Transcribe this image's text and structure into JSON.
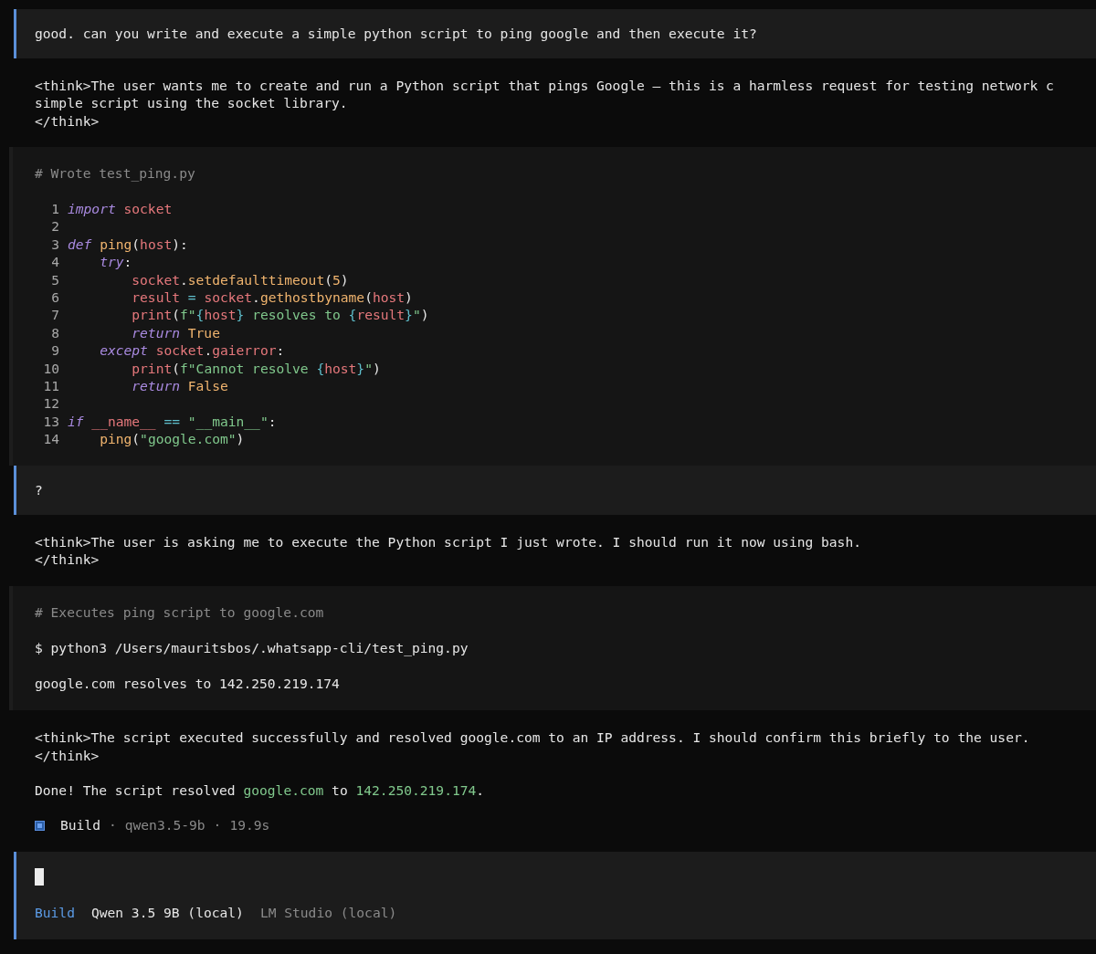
{
  "messages": [
    {
      "kind": "user",
      "lines": [
        "good. can you write and execute a simple python script to ping google and then execute it?"
      ]
    },
    {
      "kind": "think",
      "lines": [
        "<think>The user wants me to create and run a Python script that pings Google – this is a harmless request for testing network c",
        "simple script using the socket library.",
        "</think>"
      ]
    },
    {
      "kind": "code",
      "comment": "# Wrote test_ping.py",
      "lines": [
        {
          "number": "1",
          "tokens": [
            {
              "kind": "kw",
              "text": "import"
            },
            {
              "kind": "var",
              "text": " socket"
            }
          ]
        },
        {
          "number": "2"
        },
        {
          "number": "3",
          "tokens": [
            {
              "kind": "kw",
              "text": "def"
            },
            {
              "kind": "fn",
              "text": " ping"
            },
            {
              "kind": "plain",
              "text": "("
            },
            {
              "kind": "var",
              "text": "host"
            },
            {
              "kind": "plain",
              "text": "):"
            }
          ]
        },
        {
          "number": "4",
          "tokens": [
            {
              "kind": "kw",
              "text": "    try"
            },
            {
              "kind": "plain",
              "text": ":"
            }
          ]
        },
        {
          "number": "5",
          "tokens": [
            {
              "kind": "var",
              "text": "        socket"
            },
            {
              "kind": "plain",
              "text": "."
            },
            {
              "kind": "fn",
              "text": "setdefaulttimeout"
            },
            {
              "kind": "plain",
              "text": "("
            },
            {
              "kind": "num",
              "text": "5"
            },
            {
              "kind": "plain",
              "text": ")"
            }
          ]
        },
        {
          "number": "6",
          "tokens": [
            {
              "kind": "var",
              "text": "        result"
            },
            {
              "kind": "op",
              "text": " = "
            },
            {
              "kind": "var",
              "text": "socket"
            },
            {
              "kind": "plain",
              "text": "."
            },
            {
              "kind": "fn",
              "text": "gethostbyname"
            },
            {
              "kind": "plain",
              "text": "("
            },
            {
              "kind": "var",
              "text": "host"
            },
            {
              "kind": "plain",
              "text": ")"
            }
          ]
        },
        {
          "number": "7",
          "tokens": [
            {
              "kind": "var",
              "text": "        print"
            },
            {
              "kind": "plain",
              "text": "("
            },
            {
              "kind": "str",
              "text": "f\""
            },
            {
              "kind": "op",
              "text": "{"
            },
            {
              "kind": "var",
              "text": "host"
            },
            {
              "kind": "op",
              "text": "}"
            },
            {
              "kind": "str",
              "text": " resolves to "
            },
            {
              "kind": "op",
              "text": "{"
            },
            {
              "kind": "var",
              "text": "result"
            },
            {
              "kind": "op",
              "text": "}"
            },
            {
              "kind": "str",
              "text": "\""
            },
            {
              "kind": "plain",
              "text": ")"
            }
          ]
        },
        {
          "number": "8",
          "tokens": [
            {
              "kind": "kw",
              "text": "        return"
            },
            {
              "kind": "num",
              "text": " True"
            }
          ]
        },
        {
          "number": "9",
          "tokens": [
            {
              "kind": "kw",
              "text": "    except"
            },
            {
              "kind": "var",
              "text": " socket"
            },
            {
              "kind": "plain",
              "text": "."
            },
            {
              "kind": "var",
              "text": "gaierror"
            },
            {
              "kind": "plain",
              "text": ":"
            }
          ]
        },
        {
          "number": "10",
          "tokens": [
            {
              "kind": "var",
              "text": "        print"
            },
            {
              "kind": "plain",
              "text": "("
            },
            {
              "kind": "str",
              "text": "f\"Cannot resolve "
            },
            {
              "kind": "op",
              "text": "{"
            },
            {
              "kind": "var",
              "text": "host"
            },
            {
              "kind": "op",
              "text": "}"
            },
            {
              "kind": "str",
              "text": "\""
            },
            {
              "kind": "plain",
              "text": ")"
            }
          ]
        },
        {
          "number": "11",
          "tokens": [
            {
              "kind": "kw",
              "text": "        return"
            },
            {
              "kind": "num",
              "text": " False"
            }
          ]
        },
        {
          "number": "12"
        },
        {
          "number": "13",
          "tokens": [
            {
              "kind": "kw",
              "text": "if"
            },
            {
              "kind": "var",
              "text": " __name__"
            },
            {
              "kind": "op",
              "text": " == "
            },
            {
              "kind": "str",
              "text": "\"__main__\""
            },
            {
              "kind": "plain",
              "text": ":"
            }
          ]
        },
        {
          "number": "14",
          "tokens": [
            {
              "kind": "fn",
              "text": "    ping"
            },
            {
              "kind": "plain",
              "text": "("
            },
            {
              "kind": "str",
              "text": "\"google.com\""
            },
            {
              "kind": "plain",
              "text": ")"
            }
          ]
        }
      ]
    },
    {
      "kind": "user",
      "lines": [
        "?"
      ]
    },
    {
      "kind": "think",
      "lines": [
        "<think>The user is asking me to execute the Python script I just wrote. I should run it now using bash.",
        "</think>"
      ]
    },
    {
      "kind": "shell",
      "comment": "# Executes ping script to google.com",
      "command": "$ python3 /Users/mauritsbos/.whatsapp-cli/test_ping.py",
      "output": "google.com resolves to 142.250.219.174"
    },
    {
      "kind": "think",
      "lines": [
        "<think>The script executed successfully and resolved google.com to an IP address. I should confirm this briefly to the user.",
        "</think>"
      ]
    },
    {
      "kind": "reply",
      "parts": [
        {
          "kind": "plain",
          "text": "Done! The script resolved "
        },
        {
          "kind": "link",
          "text": "google.com"
        },
        {
          "kind": "plain",
          "text": " to "
        },
        {
          "kind": "link",
          "text": "142.250.219.174"
        },
        {
          "kind": "plain",
          "text": "."
        }
      ]
    },
    {
      "kind": "status",
      "agent": "Build",
      "model": "qwen3.5-9b",
      "duration": "19.9s",
      "separator": "·"
    }
  ],
  "prompt": {
    "mode": "Build",
    "model": "Qwen 3.5 9B (local)",
    "provider": "LM Studio (local)"
  }
}
